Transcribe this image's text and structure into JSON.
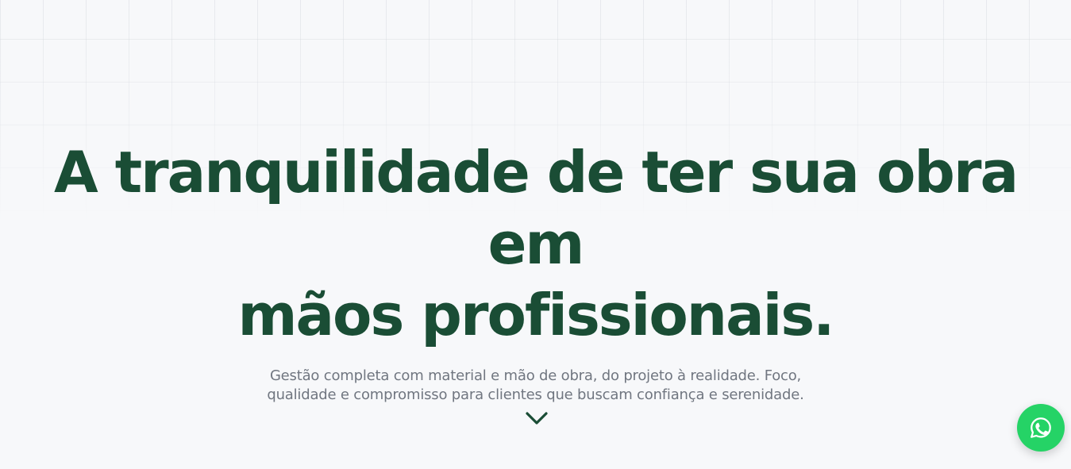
{
  "hero": {
    "title_line1": "A tranquilidade de ter sua obra em",
    "title_line2": "mãos profissionais.",
    "subtitle_line1": "Gestão completa com material e mão de obra, do projeto à realidade. Foco,",
    "subtitle_line2": "qualidade e compromisso para clientes que buscam confiança e serenidade."
  },
  "scroll": {
    "icon": "chevron-down-icon"
  },
  "whatsapp": {
    "icon": "whatsapp-icon",
    "color": "#25d366"
  },
  "colors": {
    "title": "#1a4d35",
    "subtitle": "#707680",
    "background": "#f7f8fa"
  }
}
